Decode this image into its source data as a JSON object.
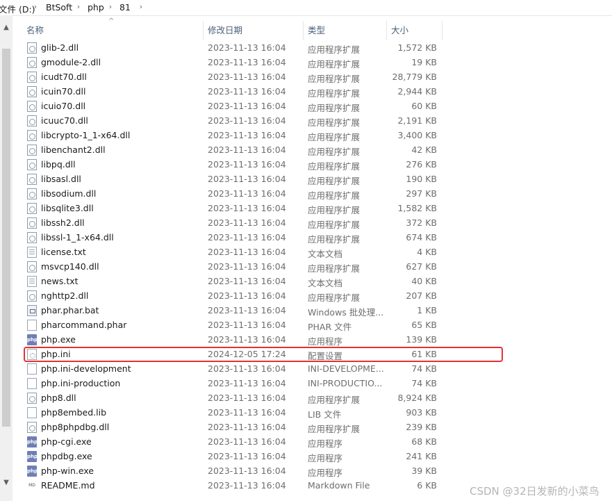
{
  "address": {
    "parts": [
      "文件 (D:)",
      "BtSoft",
      "php",
      "81"
    ]
  },
  "columns": {
    "name": "名称",
    "date": "修改日期",
    "type": "类型",
    "size": "大小"
  },
  "files": [
    {
      "name": "glib-2.dll",
      "date": "2023-11-13 16:04",
      "type": "应用程序扩展",
      "size": "1,572 KB",
      "icon": "dll-icon"
    },
    {
      "name": "gmodule-2.dll",
      "date": "2023-11-13 16:04",
      "type": "应用程序扩展",
      "size": "19 KB",
      "icon": "dll-icon"
    },
    {
      "name": "icudt70.dll",
      "date": "2023-11-13 16:04",
      "type": "应用程序扩展",
      "size": "28,779 KB",
      "icon": "dll-icon"
    },
    {
      "name": "icuin70.dll",
      "date": "2023-11-13 16:04",
      "type": "应用程序扩展",
      "size": "2,944 KB",
      "icon": "dll-icon"
    },
    {
      "name": "icuio70.dll",
      "date": "2023-11-13 16:04",
      "type": "应用程序扩展",
      "size": "60 KB",
      "icon": "dll-icon"
    },
    {
      "name": "icuuc70.dll",
      "date": "2023-11-13 16:04",
      "type": "应用程序扩展",
      "size": "2,191 KB",
      "icon": "dll-icon"
    },
    {
      "name": "libcrypto-1_1-x64.dll",
      "date": "2023-11-13 16:04",
      "type": "应用程序扩展",
      "size": "3,400 KB",
      "icon": "dll-icon"
    },
    {
      "name": "libenchant2.dll",
      "date": "2023-11-13 16:04",
      "type": "应用程序扩展",
      "size": "42 KB",
      "icon": "dll-icon"
    },
    {
      "name": "libpq.dll",
      "date": "2023-11-13 16:04",
      "type": "应用程序扩展",
      "size": "276 KB",
      "icon": "dll-icon"
    },
    {
      "name": "libsasl.dll",
      "date": "2023-11-13 16:04",
      "type": "应用程序扩展",
      "size": "190 KB",
      "icon": "dll-icon"
    },
    {
      "name": "libsodium.dll",
      "date": "2023-11-13 16:04",
      "type": "应用程序扩展",
      "size": "297 KB",
      "icon": "dll-icon"
    },
    {
      "name": "libsqlite3.dll",
      "date": "2023-11-13 16:04",
      "type": "应用程序扩展",
      "size": "1,582 KB",
      "icon": "dll-icon"
    },
    {
      "name": "libssh2.dll",
      "date": "2023-11-13 16:04",
      "type": "应用程序扩展",
      "size": "372 KB",
      "icon": "dll-icon"
    },
    {
      "name": "libssl-1_1-x64.dll",
      "date": "2023-11-13 16:04",
      "type": "应用程序扩展",
      "size": "674 KB",
      "icon": "dll-icon"
    },
    {
      "name": "license.txt",
      "date": "2023-11-13 16:04",
      "type": "文本文档",
      "size": "4 KB",
      "icon": "text-file-icon"
    },
    {
      "name": "msvcp140.dll",
      "date": "2023-11-13 16:04",
      "type": "应用程序扩展",
      "size": "627 KB",
      "icon": "dll-icon"
    },
    {
      "name": "news.txt",
      "date": "2023-11-13 16:04",
      "type": "文本文档",
      "size": "40 KB",
      "icon": "text-file-icon"
    },
    {
      "name": "nghttp2.dll",
      "date": "2023-11-13 16:04",
      "type": "应用程序扩展",
      "size": "207 KB",
      "icon": "dll-icon"
    },
    {
      "name": "phar.phar.bat",
      "date": "2023-11-13 16:04",
      "type": "Windows 批处理...",
      "size": "1 KB",
      "icon": "batch-file-icon"
    },
    {
      "name": "pharcommand.phar",
      "date": "2023-11-13 16:04",
      "type": "PHAR 文件",
      "size": "65 KB",
      "icon": "blank-file-icon"
    },
    {
      "name": "php.exe",
      "date": "2023-11-13 16:04",
      "type": "应用程序",
      "size": "139 KB",
      "icon": "php-exe-icon"
    },
    {
      "name": "php.ini",
      "date": "2024-12-05 17:24",
      "type": "配置设置",
      "size": "61 KB",
      "icon": "ini-settings-icon"
    },
    {
      "name": "php.ini-development",
      "date": "2023-11-13 16:04",
      "type": "INI-DEVELOPME...",
      "size": "74 KB",
      "icon": "blank-file-icon"
    },
    {
      "name": "php.ini-production",
      "date": "2023-11-13 16:04",
      "type": "INI-PRODUCTIO...",
      "size": "74 KB",
      "icon": "blank-file-icon"
    },
    {
      "name": "php8.dll",
      "date": "2023-11-13 16:04",
      "type": "应用程序扩展",
      "size": "8,924 KB",
      "icon": "dll-icon"
    },
    {
      "name": "php8embed.lib",
      "date": "2023-11-13 16:04",
      "type": "LIB 文件",
      "size": "903 KB",
      "icon": "blank-file-icon"
    },
    {
      "name": "php8phpdbg.dll",
      "date": "2023-11-13 16:04",
      "type": "应用程序扩展",
      "size": "239 KB",
      "icon": "dll-icon"
    },
    {
      "name": "php-cgi.exe",
      "date": "2023-11-13 16:04",
      "type": "应用程序",
      "size": "68 KB",
      "icon": "php-exe-icon"
    },
    {
      "name": "phpdbg.exe",
      "date": "2023-11-13 16:04",
      "type": "应用程序",
      "size": "241 KB",
      "icon": "php-exe-icon"
    },
    {
      "name": "php-win.exe",
      "date": "2023-11-13 16:04",
      "type": "应用程序",
      "size": "39 KB",
      "icon": "php-exe-icon"
    },
    {
      "name": "README.md",
      "date": "2023-11-13 16:04",
      "type": "Markdown File",
      "size": "6 KB",
      "icon": "markdown-file-icon"
    }
  ],
  "highlighted_file": "php.ini",
  "icons": {
    "php_exe_label": "php",
    "markdown_label": "MD"
  },
  "watermark": "CSDN @32日发新的小菜鸟",
  "colors": {
    "highlight_border": "#e23232",
    "header_text": "#4c607a"
  }
}
